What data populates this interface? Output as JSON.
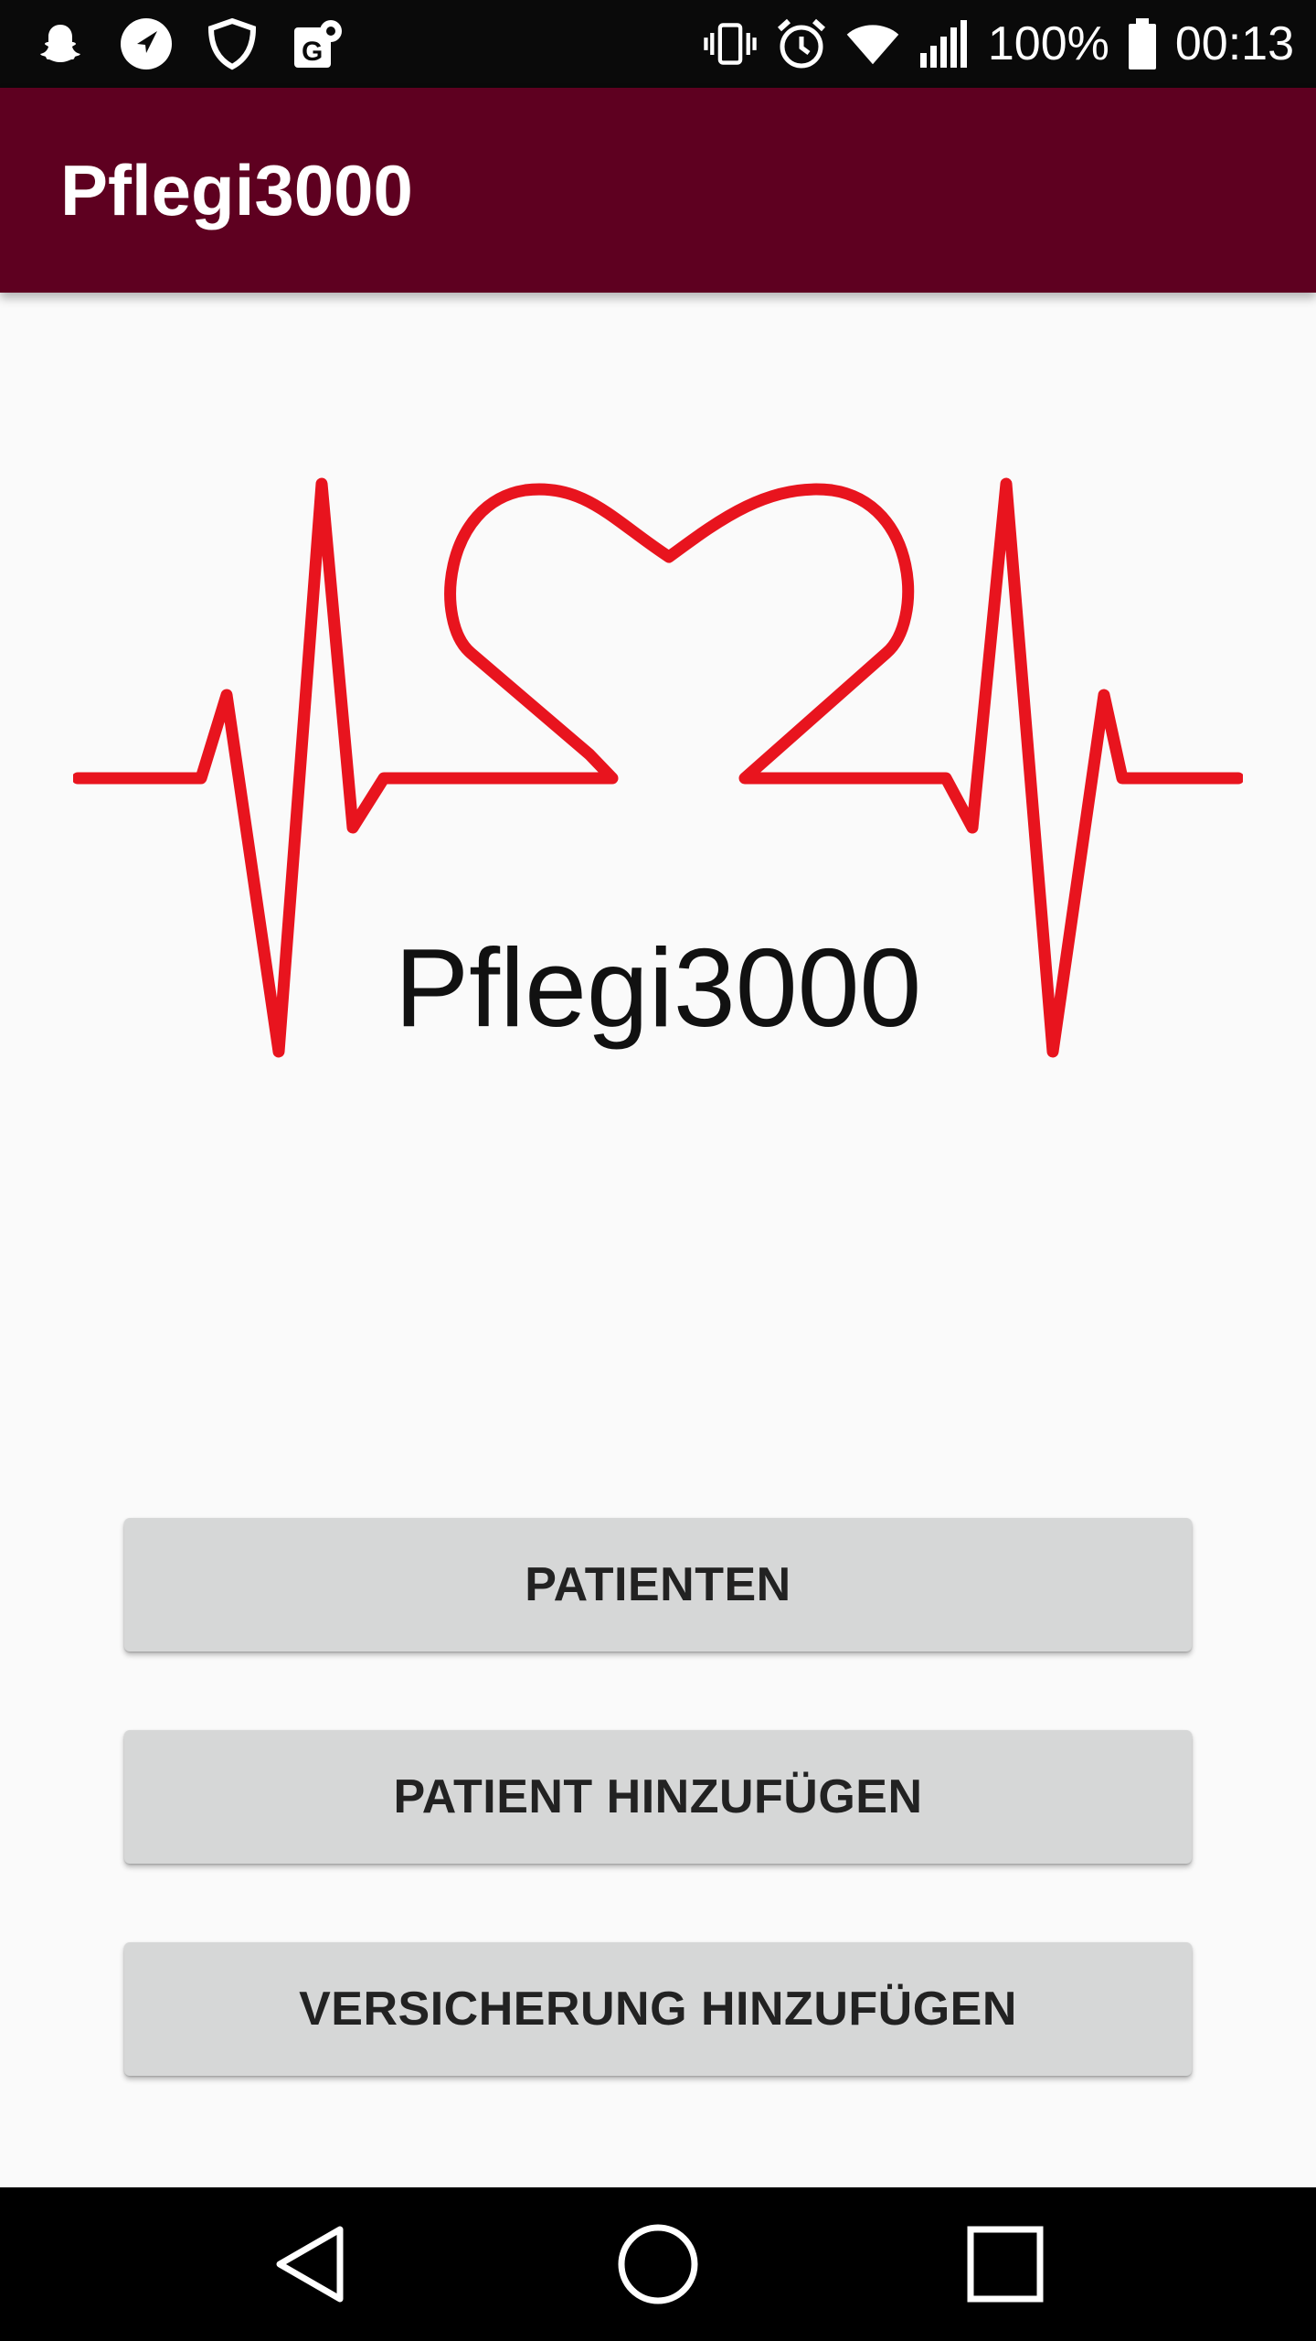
{
  "status_bar": {
    "icons_left": [
      "snapchat-icon",
      "navigation-icon",
      "shield-icon",
      "maps-icon"
    ],
    "icons_right": [
      "vibrate-icon",
      "alarm-icon",
      "wifi-icon",
      "signal-icon"
    ],
    "battery": "100%",
    "time": "00:13"
  },
  "app_bar": {
    "title": "Pflegi3000"
  },
  "logo": {
    "text": "Pflegi3000",
    "line_color": "#e8141e"
  },
  "buttons": {
    "patients": "PATIENTEN",
    "add_patient": "PATIENT HINZUFÜGEN",
    "add_insurance": "VERSICHERUNG HINZUFÜGEN"
  },
  "nav_bar": {
    "icons": [
      "back-icon",
      "home-icon",
      "recents-icon"
    ]
  },
  "colors": {
    "app_bar": "#5e0020",
    "button": "#d6d7d7",
    "background": "#fafafa"
  }
}
